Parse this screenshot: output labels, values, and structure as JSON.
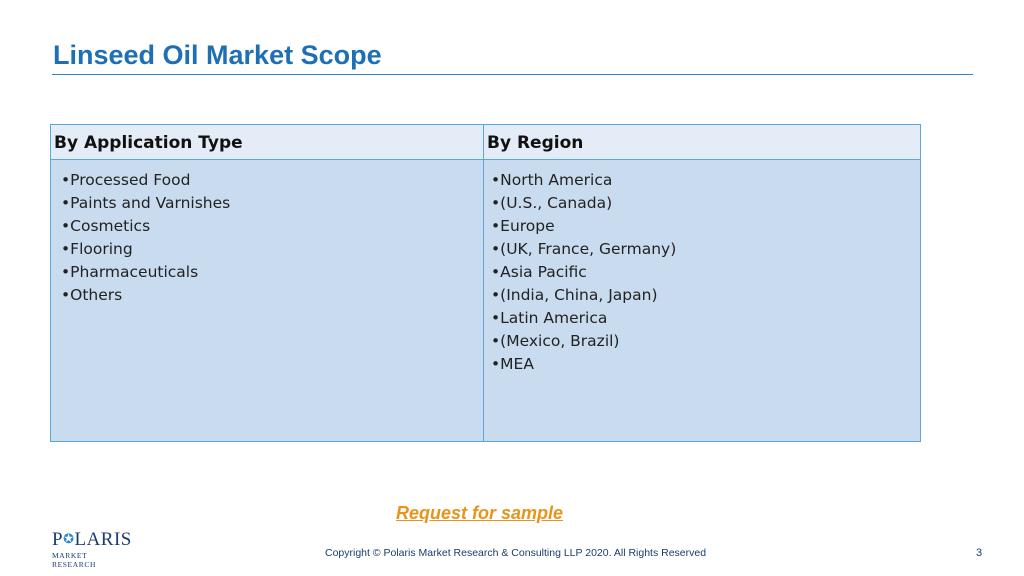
{
  "slide": {
    "title": "Linseed Oil Market Scope",
    "page_number": "3"
  },
  "table": {
    "left_header": "By Application Type",
    "right_header": "By Region",
    "left_items": [
      "Processed Food",
      "Paints and Varnishes",
      "Cosmetics",
      "Flooring",
      "Pharmaceuticals",
      "Others"
    ],
    "right_items": [
      "North America",
      "(U.S., Canada)",
      "Europe",
      "(UK, France, Germany)",
      "Asia Pacific",
      "(India, China, Japan)",
      "Latin America",
      "(Mexico, Brazil)",
      "MEA"
    ]
  },
  "request_link": "Request for sample",
  "footer": {
    "logo_main_1": "P",
    "logo_main_2": "LARIS",
    "logo_sub": "MARKET RESEARCH",
    "copyright": "Copyright © Polaris Market Research & Consulting LLP 2020. All Rights Reserved"
  },
  "colors": {
    "title": "#1f6fb4",
    "table_body": "#c9dcef",
    "table_header": "#e4edf7",
    "link": "#e8941a"
  }
}
